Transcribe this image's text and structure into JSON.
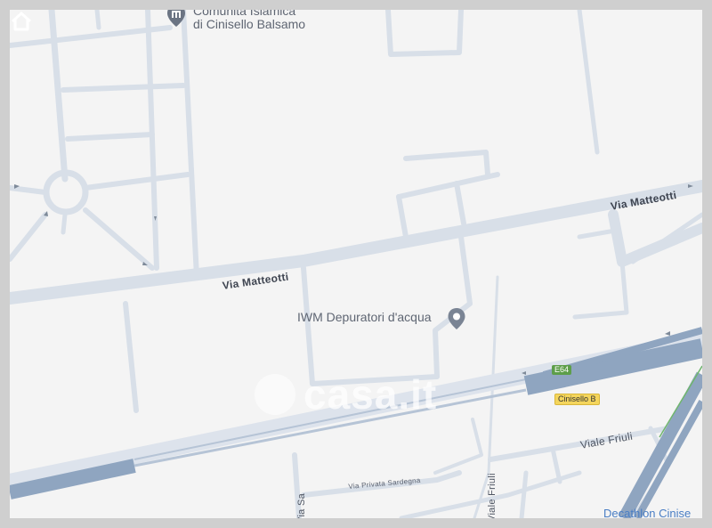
{
  "map": {
    "pois": [
      {
        "name_line1": "Comunità Islamica",
        "name_line2": "di Cinisello Balsamo",
        "icon": "mosque-icon"
      },
      {
        "name": "IWM Depuratori d'acqua",
        "icon": "location-pin-icon"
      }
    ],
    "streets": {
      "matteotti_left": "Via Matteotti",
      "matteotti_right": "Via Matteotti",
      "viale_friuli": "Viale Friuli",
      "via_privata_sardegna": "Via Privata Sardegna",
      "viale_friuli_vertical": "Viale Friuli",
      "via_sa": "Via Sa"
    },
    "shields": {
      "route": "E64",
      "exit": "Cinisello B"
    },
    "business": "Decathlon Cinise",
    "watermark": "casa.it",
    "colors": {
      "background": "#f4f4f4",
      "road": "#d8dfe8",
      "highway": "#8fa5c0",
      "label": "#3e4450",
      "link": "#4a7ec4"
    }
  }
}
